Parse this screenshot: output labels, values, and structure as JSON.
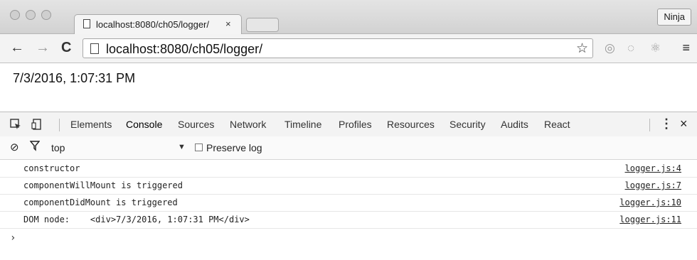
{
  "browser": {
    "tab_title": "localhost:8080/ch05/logger/",
    "tab_close": "×",
    "profile_button": "Ninja",
    "url": "localhost:8080/ch05/logger/",
    "back_glyph": "←",
    "forward_glyph": "→",
    "reload_glyph": "C",
    "bookmark_glyph": "☆",
    "menu_glyph": "≡",
    "icons": [
      "back-arrow-icon",
      "forward-arrow-icon",
      "reload-icon",
      "page-icon",
      "star-icon",
      "extension-icon",
      "react-icon",
      "menu-icon"
    ]
  },
  "page": {
    "text": "7/3/2016, 1:07:31 PM"
  },
  "devtools": {
    "tabs": [
      "Elements",
      "Console",
      "Sources",
      "Network",
      "Timeline",
      "Profiles",
      "Resources",
      "Security",
      "Audits",
      "React"
    ],
    "active_tab": "Console",
    "kebab": "⋮",
    "close": "×",
    "filter": {
      "context": "top",
      "preserve_log_label": "Preserve log",
      "preserve_log_checked": false
    },
    "logs": [
      {
        "message": "constructor",
        "source": "logger.js:4"
      },
      {
        "message": "componentWillMount is triggered",
        "source": "logger.js:7"
      },
      {
        "message": "componentDidMount is triggered",
        "source": "logger.js:10"
      },
      {
        "message": "DOM node:    <div>7/3/2016, 1:07:31 PM</div>",
        "source": "logger.js:11"
      }
    ],
    "prompt": "›"
  }
}
